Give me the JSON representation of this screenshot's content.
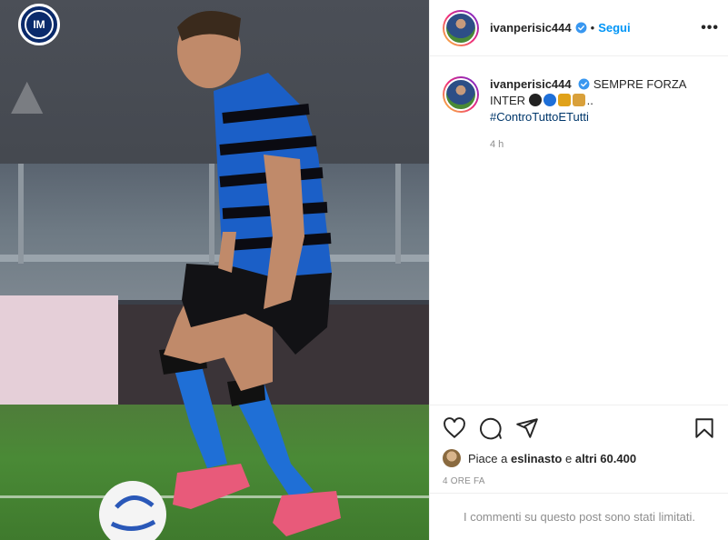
{
  "post": {
    "username": "ivanperisic444",
    "follow_label": "Segui",
    "dot": "•",
    "more_label": "•••",
    "photo_logo_text": "IM",
    "caption_username": "ivanperisic444",
    "caption_text": "SEMPRE FORZA INTER",
    "caption_tail": "..",
    "hashtag": "#ControTuttoETutti",
    "caption_time": "4 h",
    "likes_prefix": "Piace a",
    "likes_user": "eslinasto",
    "likes_middle": "e",
    "likes_others": "altri 60.400",
    "time_ago": "4 ORE FA",
    "comments_limited": "I commenti su questo post sono stati limitati."
  },
  "colors": {
    "accent": "#0095f6",
    "hashtag": "#00376b",
    "muted": "#8e8e8e",
    "inter_blue": "#0a2a6b"
  },
  "icons": [
    "heart-icon",
    "comment-icon",
    "share-icon",
    "bookmark-icon",
    "verified-icon",
    "more-options-icon"
  ]
}
